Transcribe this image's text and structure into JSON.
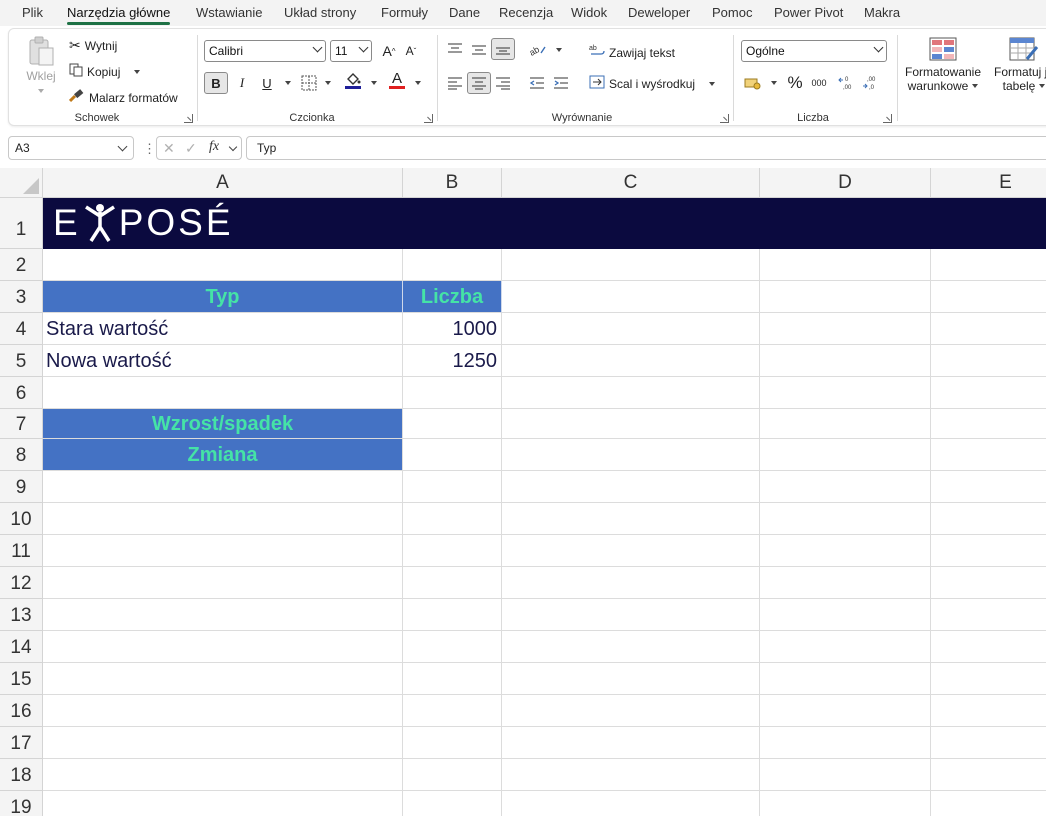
{
  "menu": {
    "tabs": [
      "Plik",
      "Narzędzia główne",
      "Wstawianie",
      "Układ strony",
      "Formuły",
      "Dane",
      "Recenzja",
      "Widok",
      "Deweloper",
      "Pomoc",
      "Power Pivot",
      "Makra"
    ],
    "active_tab": "Narzędzia główne"
  },
  "ribbon": {
    "clipboard": {
      "paste_label": "Wklej",
      "cut_label": "Wytnij",
      "copy_label": "Kopiuj",
      "format_painter_label": "Malarz formatów",
      "group_label": "Schowek"
    },
    "font": {
      "font_name": "Calibri",
      "font_size": "11",
      "bold": "B",
      "italic": "I",
      "underline": "U",
      "group_label": "Czcionka",
      "fill_color": "#1f1f99",
      "font_color": "#e02020"
    },
    "alignment": {
      "wrap_text_label": "Zawijaj tekst",
      "merge_center_label": "Scal i wyśrodkuj",
      "group_label": "Wyrównanie"
    },
    "number": {
      "format": "Ogólne",
      "group_label": "Liczba"
    },
    "styles": {
      "conditional_formatting_label_1": "Formatowanie",
      "conditional_formatting_label_2": "warunkowe",
      "format_as_table_label_1": "Formatuj ja",
      "format_as_table_label_2": "tabelę"
    }
  },
  "formula_bar": {
    "name_box": "A3",
    "content": "Typ"
  },
  "sheet": {
    "columns": [
      "A",
      "B",
      "C",
      "D",
      "E"
    ],
    "rows": [
      "1",
      "2",
      "3",
      "4",
      "5",
      "6",
      "7",
      "8",
      "9",
      "10",
      "11",
      "12",
      "13",
      "14",
      "15",
      "16",
      "17",
      "18",
      "19"
    ],
    "banner_text": "EXPOSÉ",
    "banner_color": "#0b0a3f",
    "header_fill": "#4472c4",
    "header_text_color": "#45e3a6",
    "cells": {
      "A3": "Typ",
      "B3": "Liczba",
      "A4": "Stara wartość",
      "B4": "1000",
      "A5": "Nowa wartość",
      "B5": "1250",
      "A7": "Wzrost/spadek",
      "A8": "Zmiana"
    }
  }
}
